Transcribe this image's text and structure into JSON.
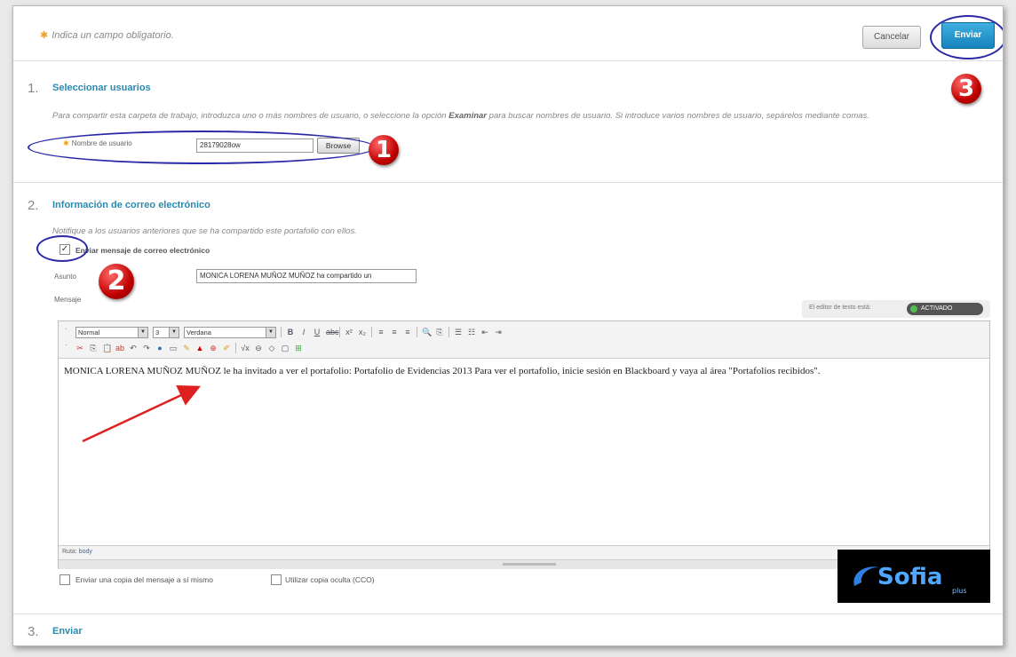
{
  "header": {
    "required_note": "Indica un campo obligatorio.",
    "cancel_label": "Cancelar",
    "send_label": "Enviar"
  },
  "section1": {
    "number": "1.",
    "title": "Seleccionar usuarios",
    "help_part1": "Para compartir esta carpeta de trabajo, introduzca uno o más nombres de usuario, o seleccione la opción ",
    "help_bold": "Examinar",
    "help_part2": " para buscar nombres de usuario. Si introduce varios nombres de usuario, sepárelos mediante comas.",
    "username_label": "Nombre de usuario",
    "username_value": "28179028ow",
    "browse_label": "Browse"
  },
  "section2": {
    "number": "2.",
    "title": "Información de correo electrónico",
    "help": "Notifique a los usuarios anteriores que se ha compartido este portafolio con ellos.",
    "send_email_label": "Enviar mensaje de correo electrónico",
    "subject_label": "Asunto",
    "subject_value": "MONICA LORENA MUÑOZ MUÑOZ ha compartido un",
    "message_label": "Mensaje",
    "editor_status_label": "El editor de texto está:",
    "editor_status_value": "ACTIVADO",
    "toolbar": {
      "format": "Normal",
      "size": "3",
      "font": "Verdana"
    },
    "message_body": "MONICA LORENA MUÑOZ MUÑOZ le ha invitado a ver el portafolio: Portafolio de Evidencias 2013 Para ver el portafolio, inicie sesión en Blackboard y vaya al área \"Portafolios recibidos\".",
    "path_label": "Ruta:",
    "path_value": "body",
    "copy_self_label": "Enviar una copia del mensaje a sí mismo",
    "bcc_label": "Utilizar copia oculta (CCO)"
  },
  "section3": {
    "number": "3.",
    "title": "Enviar"
  },
  "annotations": {
    "badge1": "1",
    "badge2": "2",
    "badge3": "3"
  },
  "logo": {
    "text": "Sofia plus"
  },
  "colors": {
    "accent": "#2a8ab0",
    "send_button": "#1682bd",
    "annotation_oval": "#2a2aa8",
    "annotation_badge": "#c00000",
    "arrow": "#e02020"
  }
}
